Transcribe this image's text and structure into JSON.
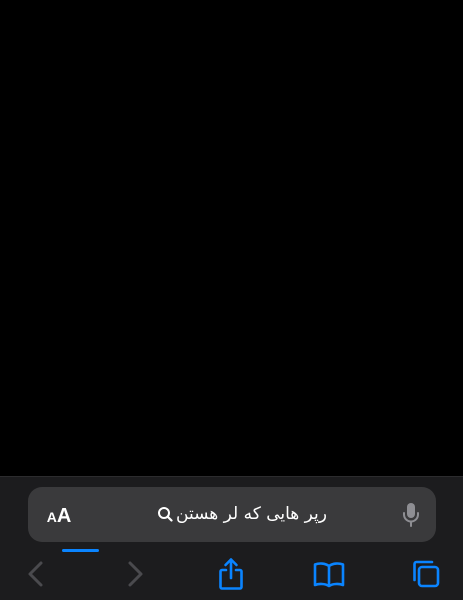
{
  "browser": {
    "address_bar": {
      "reader_button_small": "A",
      "reader_button_large": "A",
      "query": "رپر هایی که لر هستن",
      "load_progress": 0.09
    },
    "toolbar": {
      "icons": [
        "back-icon",
        "forward-icon",
        "share-icon",
        "bookmarks-icon",
        "tabs-icon"
      ]
    },
    "colors": {
      "accent": "#0a84ff",
      "chrome_background": "#1c1c1e",
      "address_bar_background": "#3a3a3c",
      "disabled_icon": "#4a4a4e"
    }
  }
}
